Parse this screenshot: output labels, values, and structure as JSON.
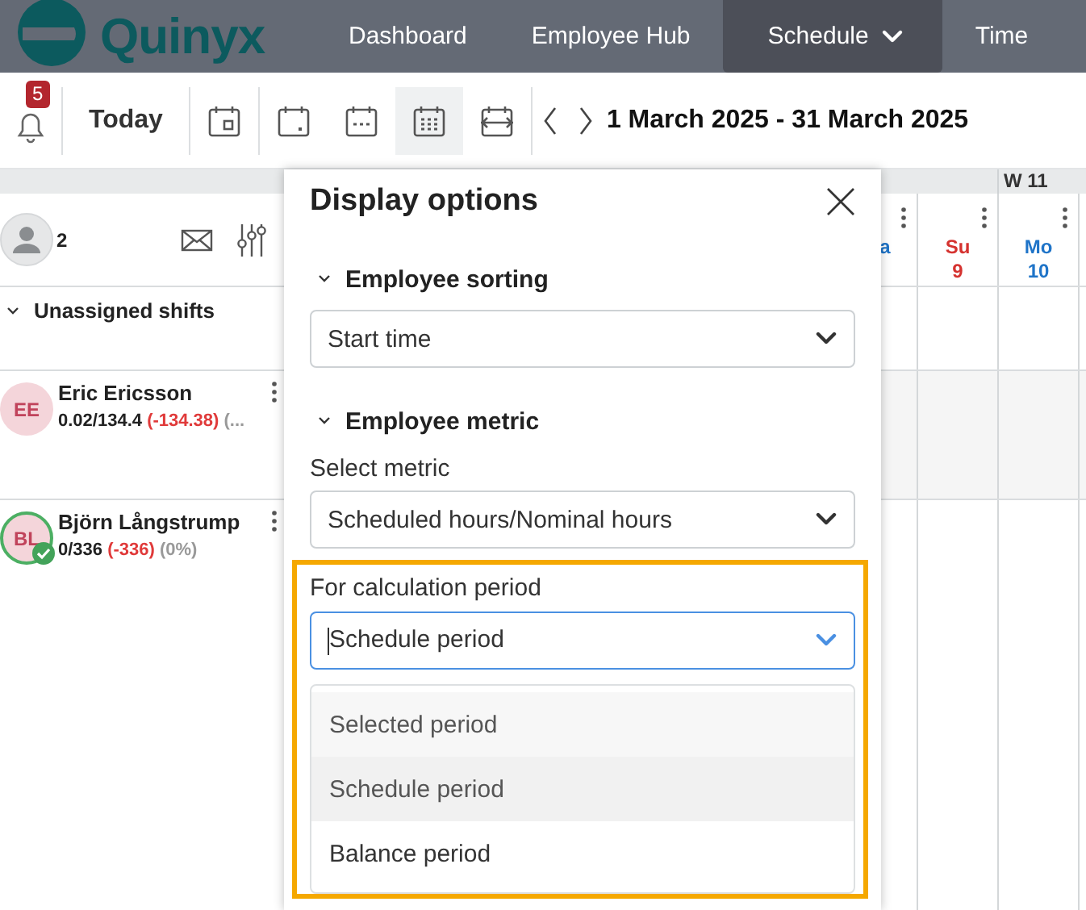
{
  "nav": {
    "logo": "Quinyx",
    "items": [
      {
        "label": "Dashboard",
        "selected": false,
        "menu": false
      },
      {
        "label": "Employee Hub",
        "selected": false,
        "menu": false
      },
      {
        "label": "Schedule",
        "selected": true,
        "menu": true
      },
      {
        "label": "Time",
        "selected": false,
        "menu": false
      }
    ]
  },
  "toolbar": {
    "notification_count": "5",
    "today": "Today",
    "views": [
      {
        "kind": "day",
        "selected": false
      },
      {
        "kind": "single",
        "selected": false
      },
      {
        "kind": "row",
        "selected": false
      },
      {
        "kind": "month",
        "selected": true
      },
      {
        "kind": "period",
        "selected": false
      }
    ],
    "date_range": "1 March 2025 - 31 March 2025"
  },
  "schedule": {
    "week": "W 11",
    "headcount": "2",
    "days": [
      {
        "day": "a",
        "color": "#1f74c8"
      },
      {
        "day": "Su",
        "date": "9",
        "color": "#d5322f"
      },
      {
        "day": "Mo",
        "date": "10",
        "color": "#1f74c8"
      }
    ],
    "rows": [
      {
        "kind": "group",
        "label": "Unassigned shifts",
        "expanded": true
      },
      {
        "kind": "employee",
        "name": "Eric Ericsson",
        "initials": "EE",
        "verified": false,
        "hours": "0.02/134.4",
        "difference": "(-134.38)",
        "share": "(..."
      },
      {
        "kind": "employee",
        "name": "Björn Långstrump",
        "initials": "BL",
        "verified": true,
        "hours": "0/336",
        "difference": "(-336)",
        "share": "(0%)"
      }
    ]
  },
  "dialog": {
    "title": "Display options",
    "sections": [
      {
        "title": "Employee sorting",
        "expanded": true,
        "fields": [
          {
            "value": "Start time",
            "focused": false,
            "highlighted": false
          }
        ]
      },
      {
        "title": "Employee metric",
        "expanded": true,
        "fields": [
          {
            "label": "Select metric",
            "value": "Scheduled hours/Nominal hours",
            "focused": false,
            "highlighted": false
          },
          {
            "label": "For calculation period",
            "value": "Schedule period",
            "focused": true,
            "highlighted": true,
            "options": [
              {
                "label": "Selected period",
                "selected": false,
                "hovered": true
              },
              {
                "label": "Schedule period",
                "selected": true,
                "hovered": false
              },
              {
                "label": "Balance period",
                "selected": false,
                "hovered": false
              }
            ]
          }
        ]
      }
    ]
  }
}
